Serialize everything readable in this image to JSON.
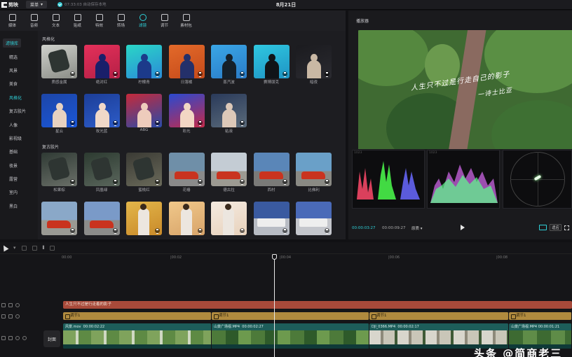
{
  "app": {
    "name": "剪映",
    "menu_label": "菜单",
    "save_status": "07:33:03 自动保存本地",
    "doc_title": "8月21日"
  },
  "toolbar": [
    {
      "name": "media",
      "label": "媒体"
    },
    {
      "name": "audio",
      "label": "音频"
    },
    {
      "name": "text",
      "label": "文本"
    },
    {
      "name": "sticker",
      "label": "贴纸"
    },
    {
      "name": "effects",
      "label": "特效"
    },
    {
      "name": "transition",
      "label": "转场"
    },
    {
      "name": "filter",
      "label": "滤镜",
      "active": true
    },
    {
      "name": "adjust",
      "label": "调节"
    },
    {
      "name": "material",
      "label": "素材包"
    }
  ],
  "categories": [
    {
      "label": "滤镜库",
      "head": true,
      "active": true
    },
    {
      "label": "精选"
    },
    {
      "label": "风景"
    },
    {
      "label": "美食"
    },
    {
      "label": "风格化",
      "active": true
    },
    {
      "label": "复古胶片"
    },
    {
      "label": "人像"
    },
    {
      "label": "影视级"
    },
    {
      "label": "基础"
    },
    {
      "label": "夜景"
    },
    {
      "label": "露营"
    },
    {
      "label": "室内"
    },
    {
      "label": "黑白"
    }
  ],
  "sections": {
    "stylize": {
      "title": "风格化",
      "items": [
        {
          "label": "质感金属"
        },
        {
          "label": "绝对红"
        },
        {
          "label": "柠檬青"
        },
        {
          "label": "日落橘"
        },
        {
          "label": "蒸汽波"
        },
        {
          "label": "赛博朋克"
        },
        {
          "label": "暗夜"
        },
        {
          "label": "星云"
        },
        {
          "label": "玫光蓝"
        },
        {
          "label": "ABG"
        },
        {
          "label": "彩光"
        },
        {
          "label": "粘液"
        }
      ]
    },
    "retro": {
      "title": "复古胶片",
      "items": [
        {
          "label": "松果棕"
        },
        {
          "label": "凤凰绿"
        },
        {
          "label": "蜜桃红"
        },
        {
          "label": "花椿"
        },
        {
          "label": "德古拉"
        },
        {
          "label": "西村"
        },
        {
          "label": "比佛利"
        },
        {
          "label": ""
        },
        {
          "label": ""
        },
        {
          "label": ""
        },
        {
          "label": ""
        },
        {
          "label": ""
        },
        {
          "label": ""
        },
        {
          "label": ""
        }
      ]
    }
  },
  "preview": {
    "title": "播放器",
    "caption_line1": "人生只不过是行走自己的影子",
    "caption_line2": "一诗士比亚",
    "time_current": "00:00:03:27",
    "time_total": "00:00:09:27",
    "quality_label": "原质 ▾",
    "ratio_label": "适应"
  },
  "timeline": {
    "ruler": [
      "00:00",
      "|00:02",
      "|00:04",
      "|00:06",
      "|00:08"
    ],
    "cover_label": "封面",
    "text_clip": "人生只不过是行走着的影子",
    "adjust_clips": [
      "调节1",
      "调节1",
      "调节1",
      "调节1"
    ],
    "video_clips": [
      {
        "name": "风景.mov",
        "duration": "00:00:02:22"
      },
      {
        "name": "山景广场视.MP4",
        "duration": "00:00:02:27"
      },
      {
        "name": "DJI_0366.MP4",
        "duration": "00:00:02:17"
      },
      {
        "name": "山景广场视.MP4",
        "duration": "00:00:01:21"
      }
    ]
  },
  "watermark": "头条 @简商老三",
  "colors": {
    "accent": "#2fd0d8",
    "text_track": "#a84a3a",
    "adjust_track": "#b08a3e",
    "video_track": "#1d5d5a"
  }
}
